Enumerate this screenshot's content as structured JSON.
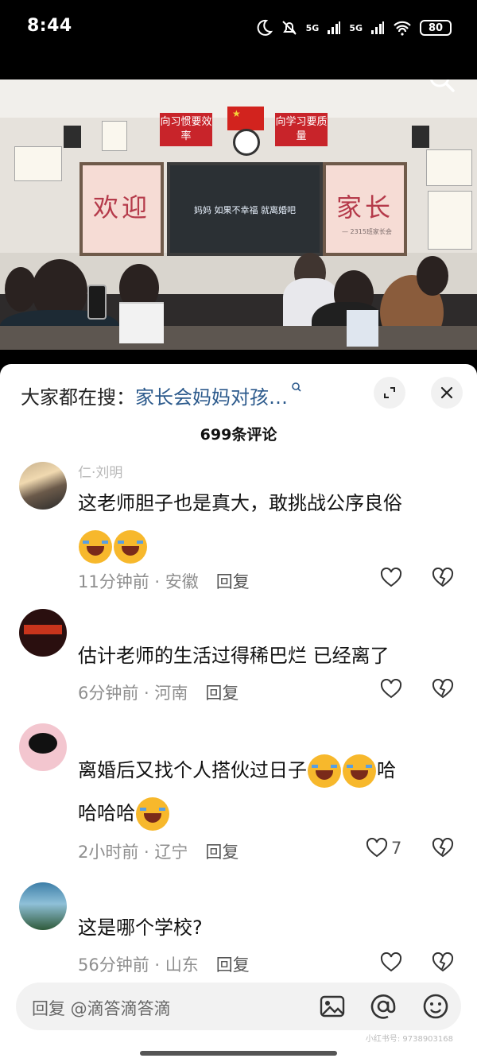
{
  "status_bar": {
    "time": "8:44",
    "signal1": "5G",
    "signal2": "5G",
    "battery": "80"
  },
  "video": {
    "banner_left": "向习惯要效率",
    "banner_right": "向学习要质量",
    "board_left": "欢迎",
    "board_right": "家长",
    "board_right_note": "— 2315班家长会",
    "screen_text": "妈妈 如果不幸福 就离婚吧"
  },
  "sheet": {
    "search_prefix": "大家都在搜：",
    "search_query": "家长会妈妈对孩…",
    "comment_count": "699条评论"
  },
  "comments": [
    {
      "name": "仁·刘明",
      "text": "这老师胆子也是真大，敢挑战公序良俗",
      "emoji_after": 2,
      "time": "11分钟前",
      "location": "安徽",
      "reply": "回复",
      "likes": ""
    },
    {
      "name": "",
      "text": "估计老师的生活过得稀巴烂 已经离了",
      "emoji_after": 0,
      "time": "6分钟前",
      "location": "河南",
      "reply": "回复",
      "likes": ""
    },
    {
      "name": "",
      "text_part1": "离婚后又找个人搭伙过日子",
      "text_part2": "哈",
      "text_part3": "哈哈哈",
      "time": "2小时前",
      "location": "辽宁",
      "reply": "回复",
      "likes": "7"
    },
    {
      "name": "",
      "text": "这是哪个学校?",
      "emoji_after": 0,
      "time": "56分钟前",
      "location": "山东",
      "reply": "回复",
      "likes": ""
    }
  ],
  "input": {
    "placeholder": "回复 @滴答滴答滴"
  },
  "watermark": "小红书号: 9738903168"
}
